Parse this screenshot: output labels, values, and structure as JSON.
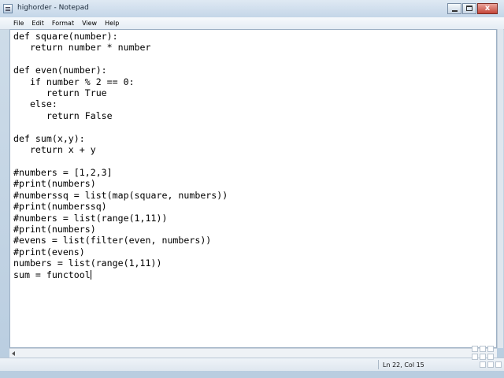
{
  "window": {
    "title": "highorder - Notepad",
    "buttons": {
      "minimize": "minimize-icon",
      "maximize": "maximize-icon",
      "close": "close-icon"
    },
    "close_glyph": "x"
  },
  "menu": {
    "items": [
      "File",
      "Edit",
      "Format",
      "View",
      "Help"
    ]
  },
  "editor": {
    "lines": [
      "def square(number):",
      "   return number * number",
      "",
      "def even(number):",
      "   if number % 2 == 0:",
      "      return True",
      "   else:",
      "      return False",
      "",
      "def sum(x,y):",
      "   return x + y",
      "",
      "#numbers = [1,2,3]",
      "#print(numbers)",
      "#numberssq = list(map(square, numbers))",
      "#print(numberssq)",
      "#numbers = list(range(1,11))",
      "#print(numbers)",
      "#evens = list(filter(even, numbers))",
      "#print(evens)",
      "numbers = list(range(1,11))",
      "sum = functool"
    ]
  },
  "status": {
    "position": "Ln 22, Col 15"
  },
  "colors": {
    "background": "#ffffff",
    "text": "#000000",
    "chrome": "#c4d6e8"
  }
}
